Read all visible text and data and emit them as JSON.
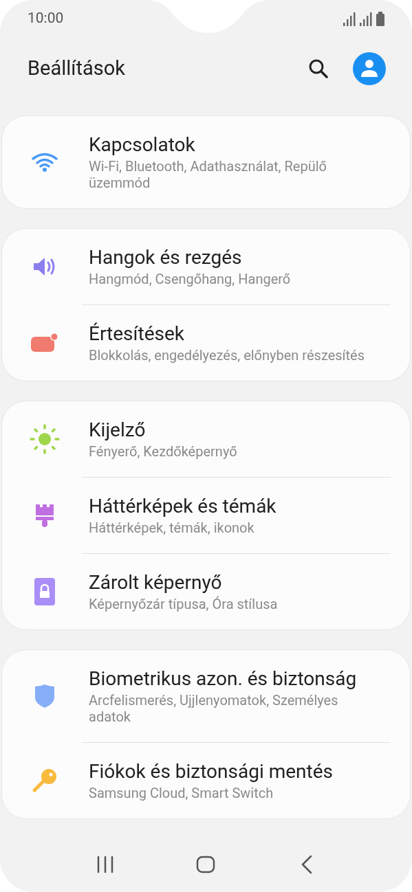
{
  "status_bar": {
    "time": "10:00"
  },
  "header": {
    "title": "Beállítások"
  },
  "groups": [
    {
      "items": [
        {
          "title": "Kapcsolatok",
          "subtitle": "Wi-Fi, Bluetooth, Adathasználat, Repülő üzemmód",
          "color": "#4a9af5"
        }
      ]
    },
    {
      "items": [
        {
          "title": "Hangok és rezgés",
          "subtitle": "Hangmód, Csengőhang, Hangerő",
          "color": "#8b7ff0"
        },
        {
          "title": "Értesítések",
          "subtitle": "Blokkolás, engedélyezés, előnyben részesítés",
          "color": "#f07b6e"
        }
      ]
    },
    {
      "items": [
        {
          "title": "Kijelző",
          "subtitle": "Fényerő, Kezdőképernyő",
          "color": "#9fd54a"
        },
        {
          "title": "Háttérképek és témák",
          "subtitle": "Háttérképek, témák, ikonok",
          "color": "#c06fe0"
        },
        {
          "title": "Zárolt képernyő",
          "subtitle": "Képernyőzár típusa, Óra stílusa",
          "color": "#a98ef8"
        }
      ]
    },
    {
      "items": [
        {
          "title": "Biometrikus azon. és biztonság",
          "subtitle": "Arcfelismerés, Ujjlenyomatok, Személyes adatok",
          "color": "#86aef8"
        },
        {
          "title": "Fiókok és biztonsági mentés",
          "subtitle": "Samsung Cloud, Smart Switch",
          "color": "#f8bb3e"
        }
      ]
    }
  ]
}
